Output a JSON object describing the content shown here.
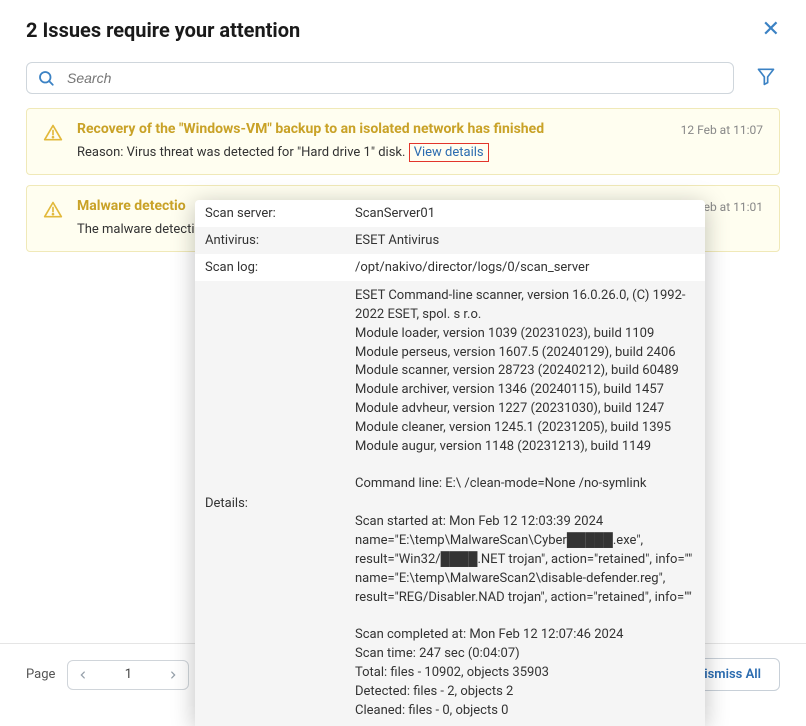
{
  "header": {
    "title": "2 Issues require your attention"
  },
  "search": {
    "placeholder": "Search"
  },
  "issues": [
    {
      "title": "Recovery of the \"Windows-VM\" backup to an isolated network has finished",
      "reason_prefix": "Reason: Virus threat was detected for \"Hard drive 1\" disk.",
      "view_details": "View details",
      "time": "12 Feb at 11:07"
    },
    {
      "title": "Malware detectio",
      "reason_prefix": "The malware detecti",
      "time": "Feb at 11:01"
    }
  ],
  "popover": {
    "rows": [
      {
        "label": "Scan server:",
        "value": "ScanServer01"
      },
      {
        "label": "Antivirus:",
        "value": "ESET Antivirus"
      },
      {
        "label": "Scan log:",
        "value": "/opt/nakivo/director/logs/0/scan_server"
      }
    ],
    "details_label": "Details:",
    "details_text": "ESET Command-line scanner, version 16.0.26.0, (C) 1992-2022 ESET, spol. s r.o.\nModule loader, version 1039 (20231023), build 1109\nModule perseus, version 1607.5 (20240129), build 2406\nModule scanner, version 28723 (20240212), build 60489\nModule archiver, version 1346 (20240115), build 1457\nModule advheur, version 1227 (20231030), build 1247\nModule cleaner, version 1245.1 (20231205), build 1395\nModule augur, version 1148 (20231213), build 1149\n\nCommand line: E:\\ /clean-mode=None /no-symlink\n\nScan started at: Mon Feb 12 12:03:39 2024\nname=\"E:\\temp\\MalwareScan\\Cyber█████.exe\", result=\"Win32/████.NET trojan\", action=\"retained\", info=\"\"\nname=\"E:\\temp\\MalwareScan2\\disable-defender.reg\", result=\"REG/Disabler.NAD trojan\", action=\"retained\", info=\"\"\n\nScan completed at: Mon Feb 12 12:07:46 2024\nScan time: 247 sec (0:04:07)\nTotal: files - 10902, objects 35903\nDetected: files - 2, objects 2\nCleaned: files - 0, objects 0"
  },
  "footer": {
    "page_label": "Page",
    "page_number": "1",
    "dismiss_all": "Dismiss All"
  }
}
